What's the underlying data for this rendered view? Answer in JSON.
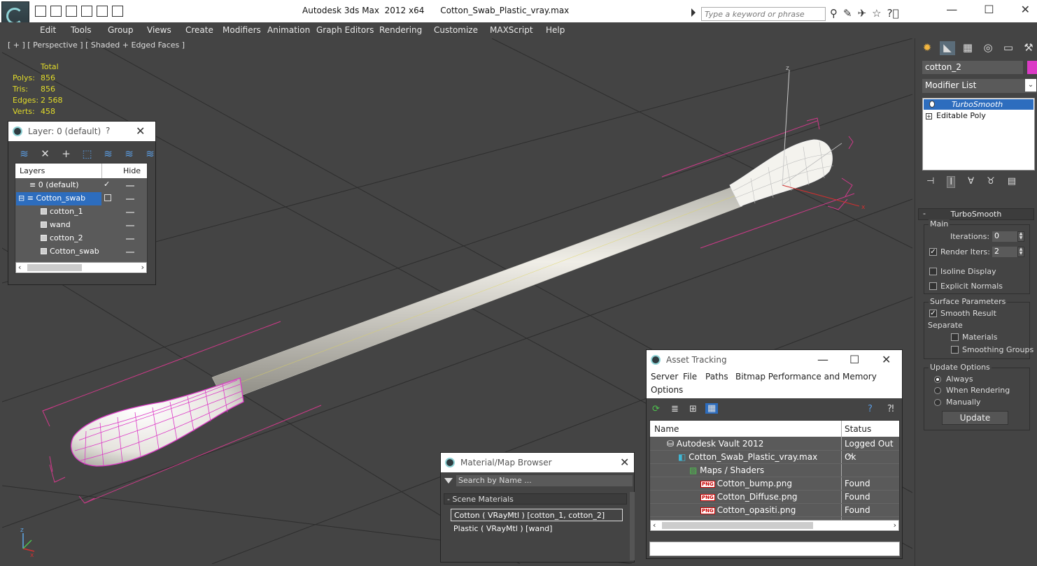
{
  "title": {
    "app": "Autodesk 3ds Max  2012 x64",
    "file": "Cotton_Swab_Plastic_vray.max",
    "search_placeholder": "Type a keyword or phrase"
  },
  "menu": [
    "Edit",
    "Tools",
    "Group",
    "Views",
    "Create",
    "Modifiers",
    "Animation",
    "Graph Editors",
    "Rendering",
    "Customize",
    "MAXScript",
    "Help"
  ],
  "viewport": {
    "label": "[ + ] [ Perspective ] [ Shaded + Edged Faces ]",
    "stats_header": "Total",
    "stats": [
      {
        "k": "Polys:",
        "v": "856"
      },
      {
        "k": "Tris:",
        "v": "856"
      },
      {
        "k": "Edges:",
        "v": "2 568"
      },
      {
        "k": "Verts:",
        "v": "458"
      }
    ],
    "gizmo_z": "z",
    "gizmo_x": "x",
    "axis_z": "z",
    "axis_x": "x",
    "wire_color": "#dc3ac6",
    "swab_color": "#e8e6df"
  },
  "command_panel": {
    "object_name": "cotton_2",
    "object_color": "#dc3ac6",
    "modifier_list_label": "Modifier List",
    "stack": {
      "selected": "TurboSmooth",
      "base": "Editable Poly"
    },
    "rollout_title": "TurboSmooth",
    "main": {
      "title": "Main",
      "iterations_label": "Iterations:",
      "iterations": "0",
      "render_iters_label": "Render Iters:",
      "render_iters": "2",
      "isoline": "Isoline Display",
      "explicit": "Explicit Normals"
    },
    "surface": {
      "title": "Surface Parameters",
      "smooth_result": "Smooth Result",
      "separate": "Separate",
      "materials": "Materials",
      "smoothing_groups": "Smoothing Groups"
    },
    "update": {
      "title": "Update Options",
      "always": "Always",
      "when_rendering": "When Rendering",
      "manually": "Manually",
      "button": "Update"
    }
  },
  "layer_window": {
    "title": "Layer: 0 (default)",
    "help": "?",
    "col_layers": "Layers",
    "col_hide": "Hide",
    "rows": [
      {
        "name": "0 (default)",
        "indent": 0
      },
      {
        "name": "Cotton_swab",
        "indent": 0
      },
      {
        "name": "cotton_1",
        "indent": 1
      },
      {
        "name": "wand",
        "indent": 1
      },
      {
        "name": "cotton_2",
        "indent": 1
      },
      {
        "name": "Cotton_swab",
        "indent": 1
      }
    ]
  },
  "material_browser": {
    "title": "Material/Map Browser",
    "search_placeholder": "Search by Name ...",
    "group": "- Scene Materials",
    "items": [
      "Cotton  ( VRayMtl )  [cotton_1, cotton_2]",
      "Plastic  ( VRayMtl )  [wand]"
    ]
  },
  "asset_tracking": {
    "title": "Asset Tracking",
    "menu_row1": [
      "Server",
      "File",
      "Paths",
      "Bitmap Performance and Memory"
    ],
    "menu_row2": [
      "Options"
    ],
    "col_name": "Name",
    "col_status": "Status",
    "rows": [
      {
        "name": "Autodesk Vault 2012",
        "status": "Logged Out ...",
        "indent": 0
      },
      {
        "name": "Cotton_Swab_Plastic_vray.max",
        "status": "Ok",
        "indent": 1
      },
      {
        "name": "Maps / Shaders",
        "status": "",
        "indent": 2
      },
      {
        "name": "Cotton_bump.png",
        "status": "Found",
        "indent": 3
      },
      {
        "name": "Cotton_Diffuse.png",
        "status": "Found",
        "indent": 3
      },
      {
        "name": "Cotton_opasiti.png",
        "status": "Found",
        "indent": 3
      }
    ],
    "png_tag": "PNG"
  }
}
